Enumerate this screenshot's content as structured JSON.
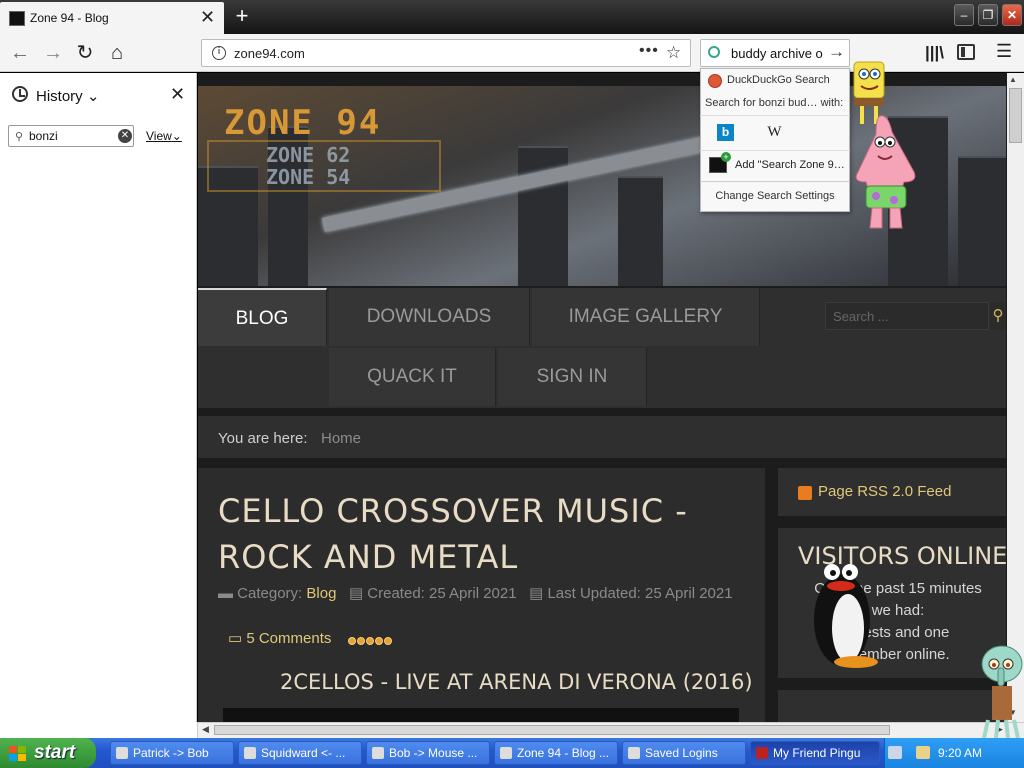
{
  "tab": {
    "title": "Zone 94 - Blog",
    "close": "✕"
  },
  "window": {
    "new_tab": "+",
    "min": "–",
    "max": "❐",
    "close": "✕"
  },
  "nav": {
    "back": "←",
    "forward": "→",
    "reload": "↻",
    "home": "⌂"
  },
  "urlbar": {
    "info": "i",
    "url": "zone94.com",
    "more": "•••",
    "bookmark": "☆"
  },
  "searchbar": {
    "value": "buddy archive o",
    "go": "→"
  },
  "toolbar": {
    "library": "|||\\",
    "menu": "☰"
  },
  "search_dropdown": {
    "engine": "DuckDuckGo Search",
    "search_for": "Search for bonzi bud… with:",
    "bing": "b",
    "wikipedia": "W",
    "add_engine": "Add \"Search Zone 9…",
    "settings": "Change Search Settings"
  },
  "sidebar": {
    "title": "History",
    "title_arrow": "⌄",
    "close": "✕",
    "search_icon": "⚲",
    "search_value": "bonzi",
    "clear": "✕",
    "view": "View",
    "view_arrow": "⌄"
  },
  "site": {
    "logo": "ZONE 94",
    "logo_sub1": "ZONE 62",
    "logo_sub2": "ZONE 54",
    "menu": [
      "BLOG",
      "DOWNLOADS",
      "IMAGE GALLERY",
      "QUACK IT",
      "SIGN IN"
    ],
    "search_placeholder": "Search ...",
    "search_btn": "⚲",
    "breadcrumb_label": "You are here:",
    "breadcrumb_home": "Home"
  },
  "article": {
    "title": "CELLO CROSSOVER MUSIC - ROCK AND METAL",
    "category_label": "Category:",
    "category": "Blog",
    "created": "Created: 25 April 2021",
    "updated": "Last Updated: 25 April 2021",
    "comments": "5 Comments",
    "rating": 5,
    "video_title": "2CELLOS - LIVE AT ARENA DI VERONA (2016)"
  },
  "right_col": {
    "rss": "Page RSS 2.0 Feed",
    "visitors_title": "VISITORS ONLINE",
    "visitors_lines": [
      "Over the past 15 minutes",
      "we had:",
      "guests and one",
      "member online."
    ]
  },
  "taskbar": {
    "start": "start",
    "items": [
      "Patrick -> Bob",
      "Squidward <- ...",
      "Bob -> Mouse ...",
      "Zone 94 - Blog ...",
      "Saved Logins",
      "My Friend Pingu"
    ],
    "clock": "9:20 AM"
  },
  "colors": {
    "accent_gold": "#e0c87a",
    "page_bg": "#1c1c1c",
    "taskbar": "#2458d0",
    "start_green": "#3a9a3a"
  }
}
